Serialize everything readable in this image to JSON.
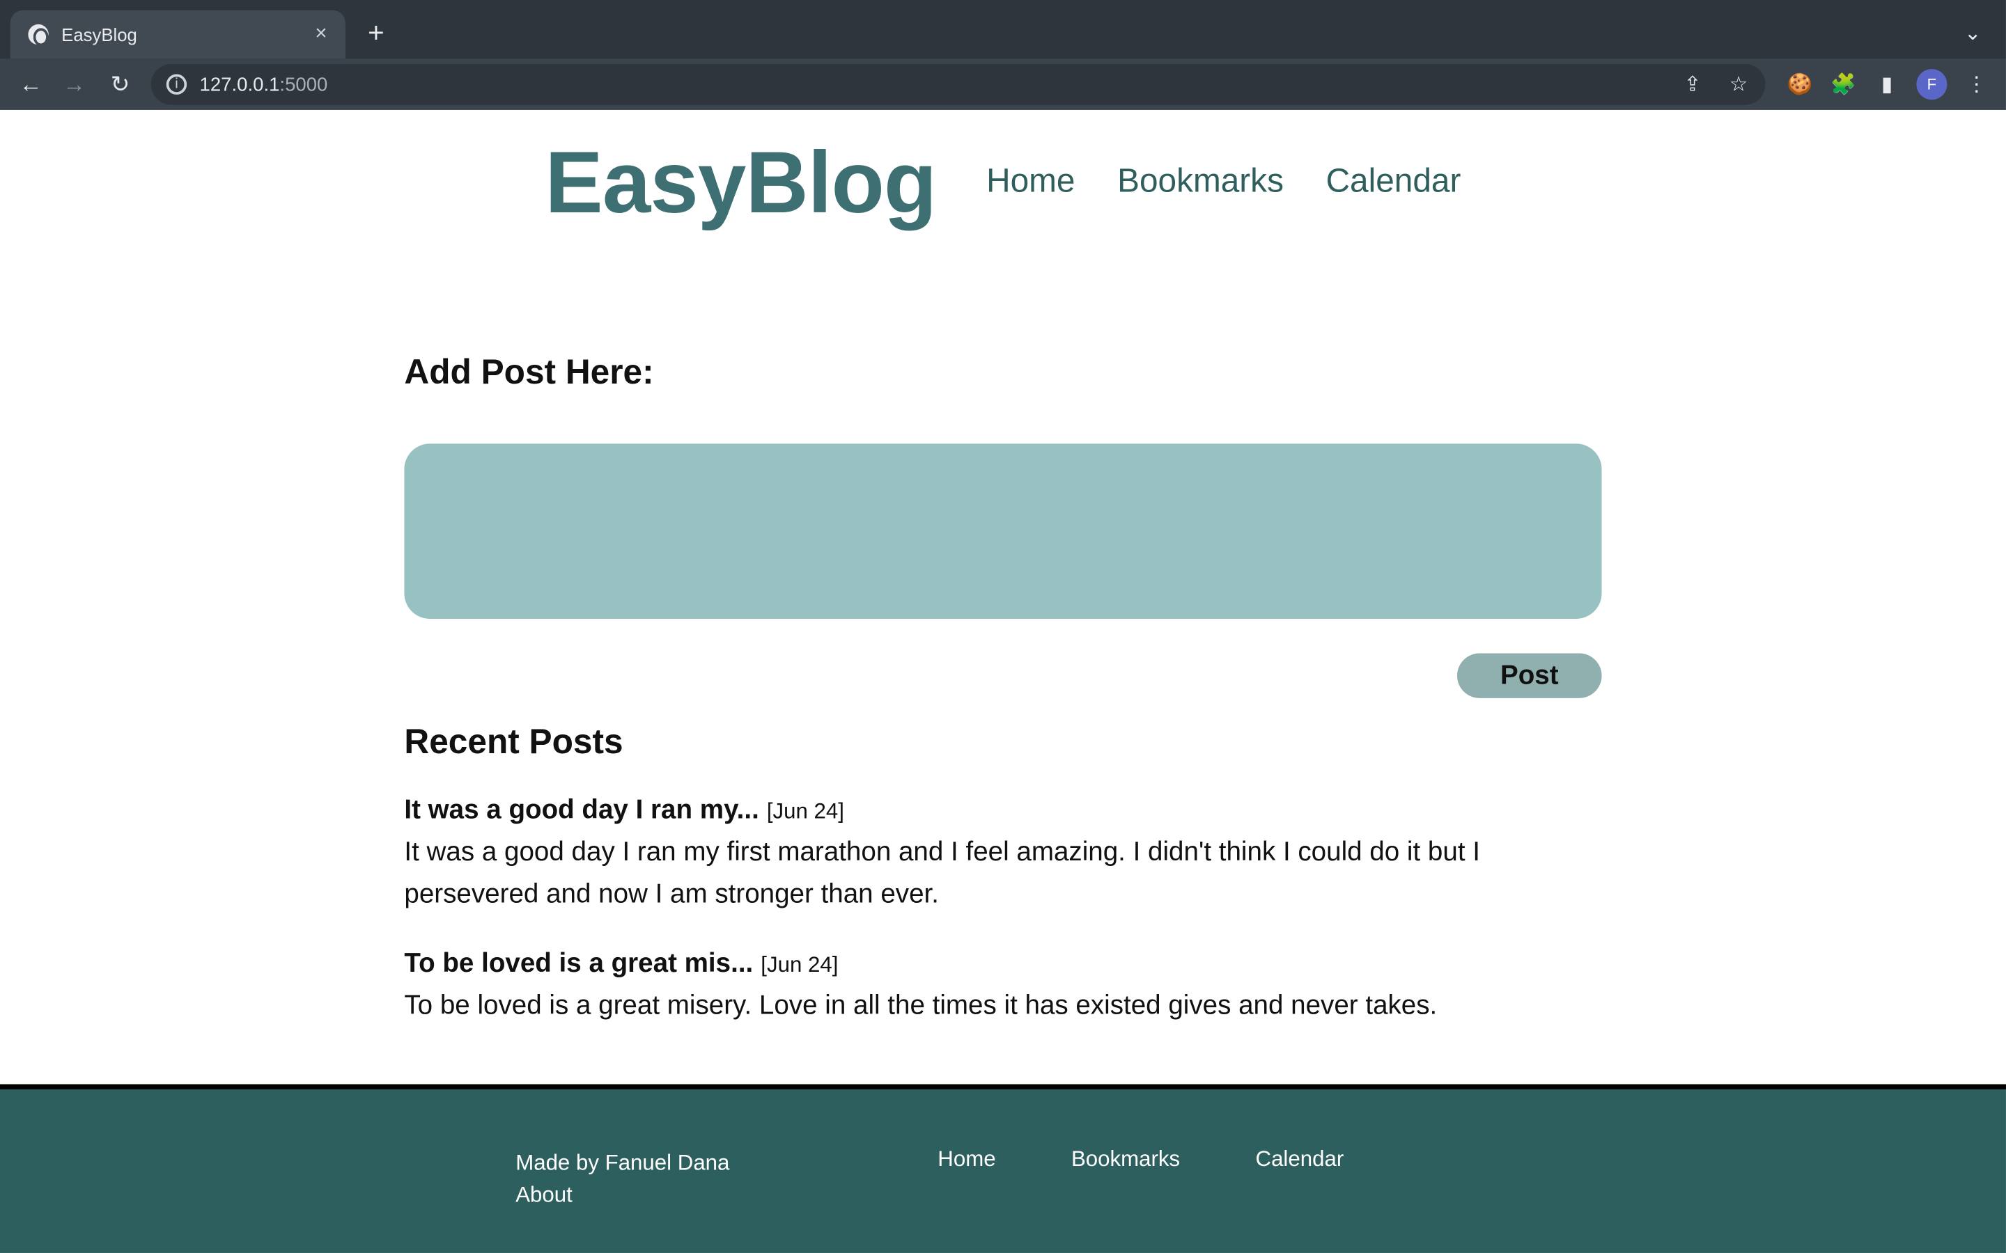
{
  "browser": {
    "tab": {
      "title": "EasyBlog",
      "close_label": "×"
    },
    "new_tab_label": "+",
    "tab_list_label": "⌄",
    "nav": {
      "back_label": "←",
      "forward_label": "→",
      "reload_label": "↻"
    },
    "omnibox": {
      "info_label": "i",
      "host": "127.0.0.1",
      "port": ":5000"
    },
    "toolbar_icons": {
      "share_label": "⇪",
      "bookmark_label": "☆",
      "cookie_label": "🍪",
      "extensions_label": "🧩",
      "sidepanel_label": "▮",
      "menu_label": "⋮"
    },
    "profile_initial": "F"
  },
  "site": {
    "brand": "EasyBlog",
    "nav": [
      "Home",
      "Bookmarks",
      "Calendar"
    ],
    "add_post_heading": "Add Post Here:",
    "post_button": "Post",
    "recent_heading": "Recent Posts",
    "posts": [
      {
        "title": "It was a good day I ran my...",
        "date": "[Jun 24]",
        "body": "It was a good day I ran my first marathon and I feel amazing. I didn't think I could do it but I persevered and now I am stronger than ever."
      },
      {
        "title": "To be loved is a great mis...",
        "date": "[Jun 24]",
        "body": "To be loved is a great misery. Love in all the times it has existed gives and never takes."
      }
    ],
    "footer": {
      "made_by": "Made by Fanuel Dana",
      "about": "About",
      "links": [
        "Home",
        "Bookmarks",
        "Calendar"
      ]
    }
  },
  "colors": {
    "brand": "#3e6f72",
    "textarea": "#98c2c1",
    "post_button": "#8fb0ae",
    "footer": "#2c5f5d"
  }
}
